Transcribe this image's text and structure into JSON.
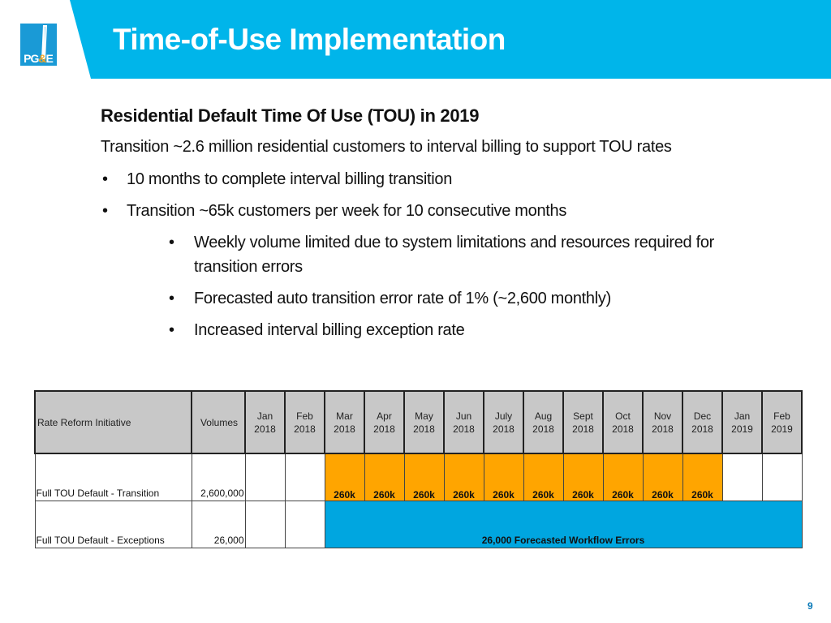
{
  "header": {
    "title": "Time-of-Use Implementation",
    "logo_text": "PG&E",
    "brand_color": "#00b5ea"
  },
  "content": {
    "subtitle": "Residential Default Time Of Use (TOU) in 2019",
    "intro": "Transition ~2.6 million residential customers to interval billing to support TOU rates",
    "bullets": [
      {
        "level": 1,
        "text": "10 months to complete interval billing transition"
      },
      {
        "level": 1,
        "text": "Transition ~65k customers per week for 10 consecutive months"
      },
      {
        "level": 2,
        "text": "Weekly volume limited due to system limitations and resources required for transition errors"
      },
      {
        "level": 2,
        "text": "Forecasted auto transition error rate of 1% (~2,600 monthly)"
      },
      {
        "level": 2,
        "text": "Increased interval billing exception rate"
      }
    ],
    "bullet_glyph": "•"
  },
  "table": {
    "headers": {
      "initiative": "Rate Reform Initiative",
      "volumes": "Volumes",
      "months": [
        [
          "Jan",
          "2018"
        ],
        [
          "Feb",
          "2018"
        ],
        [
          "Mar",
          "2018"
        ],
        [
          "Apr",
          "2018"
        ],
        [
          "May",
          "2018"
        ],
        [
          "Jun",
          "2018"
        ],
        [
          "July",
          "2018"
        ],
        [
          "Aug",
          "2018"
        ],
        [
          "Sept",
          "2018"
        ],
        [
          "Oct",
          "2018"
        ],
        [
          "Nov",
          "2018"
        ],
        [
          "Dec",
          "2018"
        ],
        [
          "Jan",
          "2019"
        ],
        [
          "Feb",
          "2019"
        ]
      ]
    },
    "rows": [
      {
        "initiative": "Full TOU Default - Transition",
        "volumes": "2,600,000",
        "monthly": [
          "",
          "",
          "260k",
          "260k",
          "260k",
          "260k",
          "260k",
          "260k",
          "260k",
          "260k",
          "260k",
          "260k",
          "",
          ""
        ]
      },
      {
        "initiative": "Full TOU Default - Exceptions",
        "volumes": "26,000",
        "monthly": [
          "",
          ""
        ],
        "span_label": "26,000 Forecasted Workflow Errors",
        "span_months": 12
      }
    ],
    "colors": {
      "header": "#c8c8c8",
      "transition": "#ffa500",
      "exceptions": "#00a6e0"
    }
  },
  "footer": {
    "page_number": "9"
  }
}
